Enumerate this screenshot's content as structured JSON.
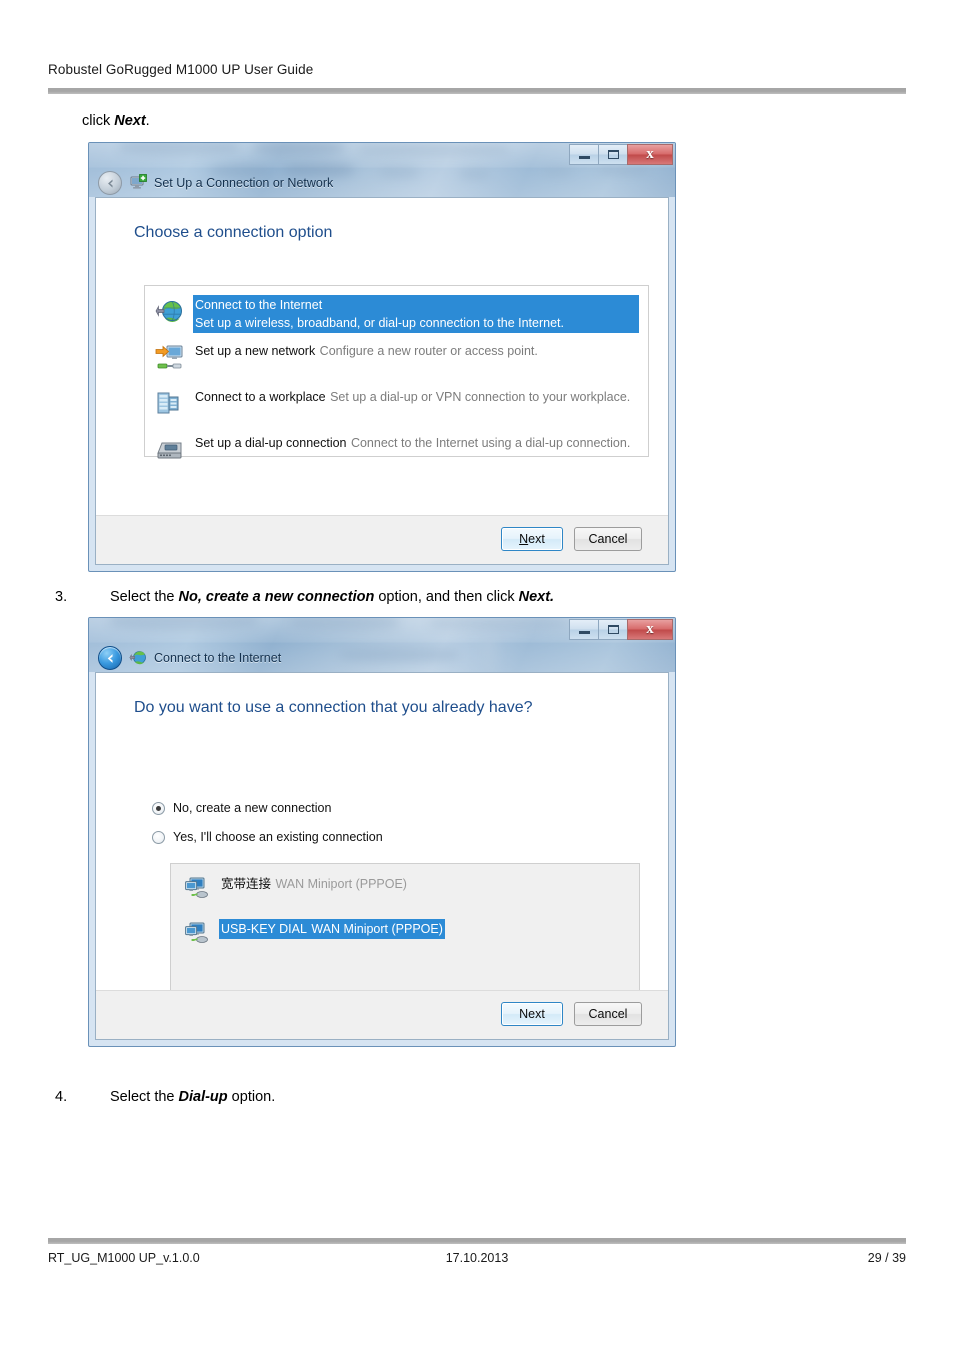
{
  "document": {
    "header_title": "Robustel GoRugged M1000 UP User Guide",
    "footer_left": "RT_UG_M1000 UP_v.1.0.0",
    "footer_center": "17.10.2013",
    "footer_right": "29 / 39"
  },
  "steps": {
    "click_next_prefix": "click ",
    "click_next_bold": "Next",
    "click_next_suffix": ".",
    "step3_number": "3.",
    "step3_a": "Select the ",
    "step3_bold1": "No, create a new connection",
    "step3_b": " option, and then click ",
    "step3_bold2": "Next.",
    "step4_number": "4.",
    "step4_a": "Select the ",
    "step4_bold1": "Dial-up",
    "step4_b": " option."
  },
  "dialog1": {
    "title": "Set Up a Connection or Network",
    "title_icon": "network-setup-icon",
    "back_icon": "back-arrow-icon",
    "window_buttons": {
      "minimize": "minimize-icon",
      "maximize": "maximize-icon",
      "close": "x"
    },
    "heading": "Choose a connection option",
    "options": [
      {
        "icon": "globe-internet-icon",
        "title": "Connect to the Internet",
        "subtitle": "Set up a wireless, broadband, or dial-up connection to the Internet.",
        "selected": true
      },
      {
        "icon": "new-network-icon",
        "title": "Set up a new network",
        "subtitle": "Configure a new router or access point.",
        "selected": false
      },
      {
        "icon": "workplace-server-icon",
        "title": "Connect to a workplace",
        "subtitle": "Set up a dial-up or VPN connection to your workplace.",
        "selected": false
      },
      {
        "icon": "dialup-modem-icon",
        "title": "Set up a dial-up connection",
        "subtitle": "Connect to the Internet using a dial-up connection.",
        "selected": false
      }
    ],
    "buttons": {
      "next": "Next",
      "next_accel": "N",
      "next_rest": "ext",
      "cancel": "Cancel"
    }
  },
  "dialog2": {
    "title": "Connect to the Internet",
    "title_icon": "globe-internet-icon",
    "back_icon": "back-arrow-icon",
    "window_buttons": {
      "minimize": "minimize-icon",
      "maximize": "maximize-icon",
      "close": "x"
    },
    "heading": "Do you want to use a connection that you already have?",
    "radios": [
      {
        "label": "No, create a new connection",
        "checked": true
      },
      {
        "label": "Yes, I'll choose an existing connection",
        "checked": false
      }
    ],
    "connections": [
      {
        "icon": "network-connection-icon",
        "name": "宽带连接",
        "device": "WAN Miniport (PPPOE)",
        "selected": false
      },
      {
        "icon": "network-connection-icon",
        "name": "USB-KEY DIAL",
        "device": "WAN Miniport (PPPOE)",
        "selected": true
      }
    ],
    "buttons": {
      "next": "Next",
      "cancel": "Cancel"
    }
  },
  "colors": {
    "selection_blue": "#2c8bd6",
    "heading_blue": "#1f4e8c",
    "rule_gray": "#a6a6a6",
    "close_red": "#c04a4a"
  }
}
